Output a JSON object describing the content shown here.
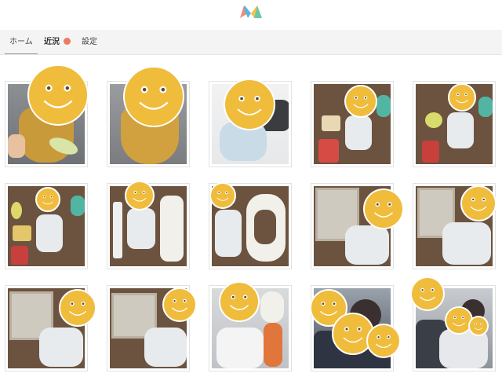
{
  "app": {
    "logo": "app-logo"
  },
  "tabs": [
    {
      "label": "ホーム",
      "active": true
    },
    {
      "label": "近況",
      "badge": "new-dot",
      "badge_color": "#ee7a60"
    },
    {
      "label": "設定"
    }
  ],
  "colors": {
    "face": "#f0bc3c",
    "tab_bar_bg": "#f4f4f4",
    "badge": "#ee7a60"
  },
  "photos": [
    {
      "subject": "baby-in-yellow-bib-with-teether",
      "faces": 1
    },
    {
      "subject": "baby-in-yellow-bib",
      "faces": 1
    },
    {
      "subject": "baby-in-onesie-on-bed",
      "faces": 1
    },
    {
      "subject": "baby-with-toys-on-brown-blanket",
      "faces": 1
    },
    {
      "subject": "baby-with-toys-on-brown-blanket",
      "faces": 1
    },
    {
      "subject": "baby-with-toys-on-brown-blanket",
      "faces": 1
    },
    {
      "subject": "baby-with-diaper-numbers",
      "faces": 1
    },
    {
      "subject": "baby-with-diaper-numbers",
      "faces": 1
    },
    {
      "subject": "baby-with-10-month-card",
      "faces": 1
    },
    {
      "subject": "baby-with-10-month-card",
      "faces": 1
    },
    {
      "subject": "baby-with-10-month-card",
      "faces": 1
    },
    {
      "subject": "baby-with-10-month-card",
      "faces": 1
    },
    {
      "subject": "baby-with-plush-bunny",
      "faces": 1
    },
    {
      "subject": "family-group",
      "faces": 3
    },
    {
      "subject": "family-group",
      "faces": 3
    }
  ]
}
